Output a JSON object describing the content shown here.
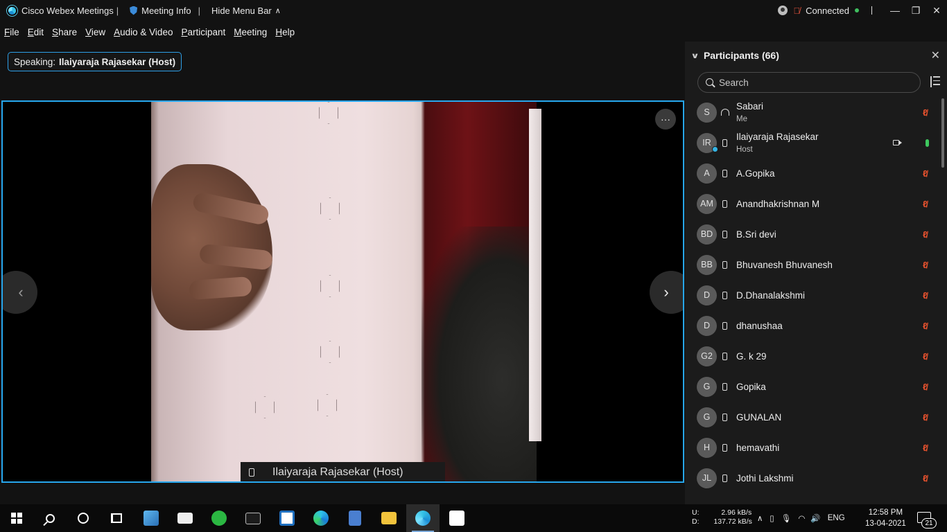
{
  "titlebar": {
    "app_name": "Cisco Webex Meetings",
    "meeting_info": "Meeting Info",
    "hide_menu": "Hide Menu Bar",
    "status": "Connected"
  },
  "menu": [
    "File",
    "Edit",
    "Share",
    "View",
    "Audio & Video",
    "Participant",
    "Meeting",
    "Help"
  ],
  "speaking": {
    "prefix": "Speaking:",
    "name": "Ilaiyaraja Rajasekar (Host)"
  },
  "video": {
    "name_label": "Ilaiyaraja Rajasekar  (Host)",
    "more": "···"
  },
  "participants": {
    "title": "Participants (66)",
    "search_placeholder": "Search",
    "list": [
      {
        "initials": "S",
        "name": "Sabari",
        "role": "Me",
        "device": "headset",
        "mic": "muted"
      },
      {
        "initials": "IR",
        "name": "Ilaiyaraja Rajasekar",
        "role": "Host",
        "device": "phone",
        "mic": "on",
        "video": true
      },
      {
        "initials": "A",
        "name": "A.Gopika",
        "device": "phone",
        "mic": "muted"
      },
      {
        "initials": "AM",
        "name": "Anandhakrishnan M",
        "device": "phone",
        "mic": "muted"
      },
      {
        "initials": "BD",
        "name": "B.Sri devi",
        "device": "phone",
        "mic": "muted"
      },
      {
        "initials": "BB",
        "name": "Bhuvanesh Bhuvanesh",
        "device": "phone",
        "mic": "muted"
      },
      {
        "initials": "D",
        "name": "D.Dhanalakshmi",
        "device": "phone",
        "mic": "muted"
      },
      {
        "initials": "D",
        "name": "dhanushaa",
        "device": "phone",
        "mic": "muted"
      },
      {
        "initials": "G2",
        "name": "G. k 29",
        "device": "phone",
        "mic": "muted"
      },
      {
        "initials": "G",
        "name": "Gopika",
        "device": "phone",
        "mic": "muted"
      },
      {
        "initials": "G",
        "name": "GUNALAN",
        "device": "phone",
        "mic": "muted"
      },
      {
        "initials": "H",
        "name": "hemavathi",
        "device": "phone",
        "mic": "muted"
      },
      {
        "initials": "JL",
        "name": "Jothi Lakshmi",
        "device": "phone",
        "mic": "muted"
      }
    ]
  },
  "taskbar": {
    "net_up": "2.96 kB/s",
    "net_down": "137.72 kB/s",
    "net_up_label": "U:",
    "net_down_label": "D:",
    "lang": "ENG",
    "time": "12:58 PM",
    "date": "13-04-2021",
    "notifications": "21"
  },
  "colors": {
    "accent": "#27a7ee",
    "muted": "#e8522e",
    "mic_on": "#3ec85e"
  }
}
